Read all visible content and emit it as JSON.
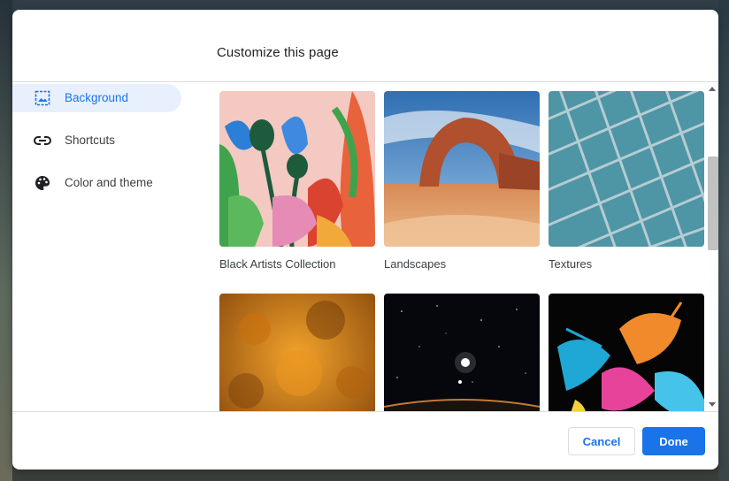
{
  "dialog": {
    "title": "Customize this page"
  },
  "sidebar": {
    "items": [
      {
        "label": "Background",
        "icon": "image-icon",
        "active": true
      },
      {
        "label": "Shortcuts",
        "icon": "link-icon",
        "active": false
      },
      {
        "label": "Color and theme",
        "icon": "palette-icon",
        "active": false
      }
    ]
  },
  "collections": [
    {
      "label": "Black Artists Collection"
    },
    {
      "label": "Landscapes"
    },
    {
      "label": "Textures"
    },
    {
      "label": ""
    },
    {
      "label": ""
    },
    {
      "label": ""
    }
  ],
  "footer": {
    "cancel_label": "Cancel",
    "done_label": "Done"
  },
  "colors": {
    "accent": "#1a73e8",
    "active_nav_bg": "#e8f0fe",
    "text": "#3c4043"
  }
}
